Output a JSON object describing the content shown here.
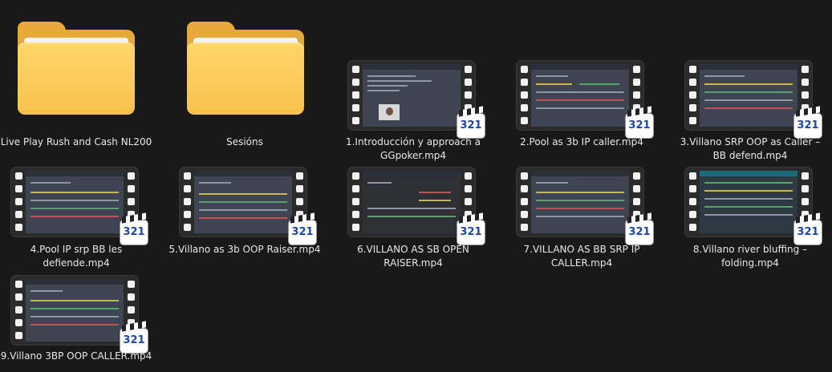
{
  "items": [
    {
      "name": "Live Play Rush and Cash NL200",
      "type": "folder"
    },
    {
      "name": "Sesións",
      "type": "folder"
    },
    {
      "name": "1.Introducción y approach a GGpoker.mp4",
      "type": "video"
    },
    {
      "name": "2.Pool as 3b IP caller.mp4",
      "type": "video"
    },
    {
      "name": "3.Villano SRP OOP as Caller – BB defend.mp4",
      "type": "video"
    },
    {
      "name": "4.Pool IP srp BB les defiende.mp4",
      "type": "video"
    },
    {
      "name": "5.Villano as 3b OOP Raiser.mp4",
      "type": "video"
    },
    {
      "name": "6.VILLANO AS SB OPEN RAISER.mp4",
      "type": "video"
    },
    {
      "name": "7.VILLANO AS BB SRP IP CALLER.mp4",
      "type": "video"
    },
    {
      "name": "8.Villano river bluffing – folding.mp4",
      "type": "video"
    },
    {
      "name": "9.Villano 3BP OOP CALLER.mp4",
      "type": "video"
    }
  ],
  "badge_text": "321",
  "icons": {
    "folder": "folder-icon",
    "video": "video-file-icon"
  },
  "colors": {
    "background": "#191919",
    "folder": "#f7c14c",
    "text": "#e8e8e8"
  }
}
